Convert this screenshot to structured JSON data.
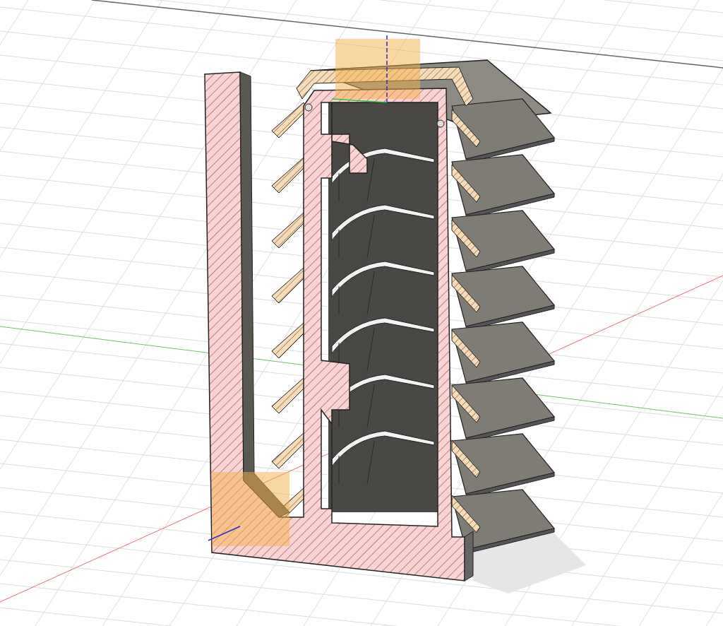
{
  "viewport": {
    "grid": true,
    "origin_axes": true,
    "section_hatching": true,
    "sketch_planes": true
  }
}
